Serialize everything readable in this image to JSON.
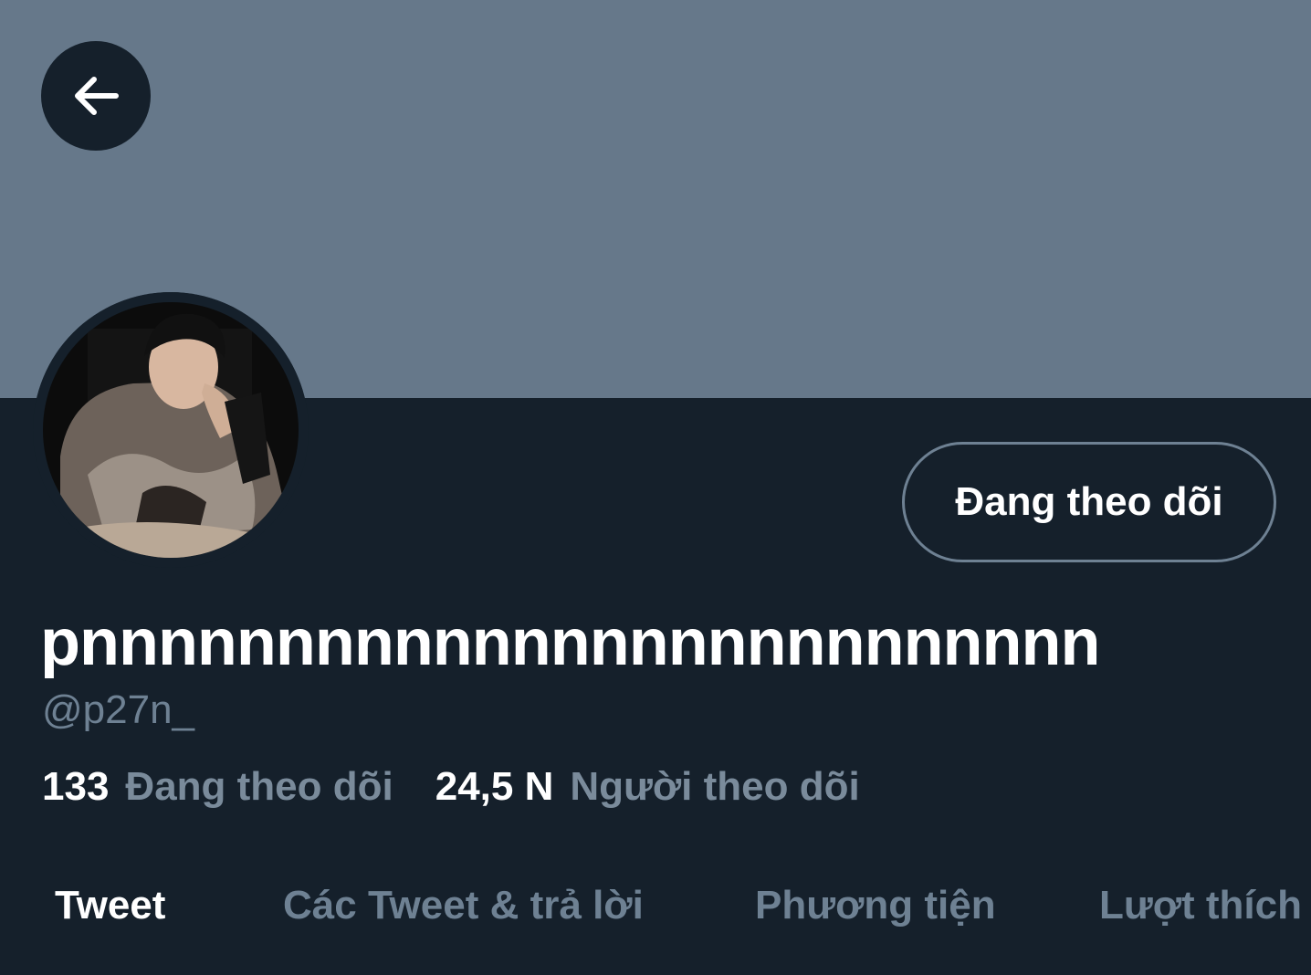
{
  "profile": {
    "display_name": "pnnnnnnnnnnnnnnnnnnnnnnnnnn",
    "handle": "@p27n_",
    "follow_button_label": "Đang theo dõi",
    "stats": {
      "following_count": "133",
      "following_label": "Đang theo dõi",
      "followers_count": "24,5 N",
      "followers_label": "Người theo dõi"
    }
  },
  "tabs": [
    {
      "label": "Tweet",
      "active": true
    },
    {
      "label": "Các Tweet & trả lời",
      "active": false
    },
    {
      "label": "Phương tiện",
      "active": false
    },
    {
      "label": "Lượt thích",
      "active": false
    }
  ],
  "colors": {
    "banner": "#66788a",
    "background": "#15202b",
    "text_primary": "#ffffff",
    "text_secondary": "#6e8193"
  },
  "icons": {
    "back": "arrow-left-icon"
  }
}
